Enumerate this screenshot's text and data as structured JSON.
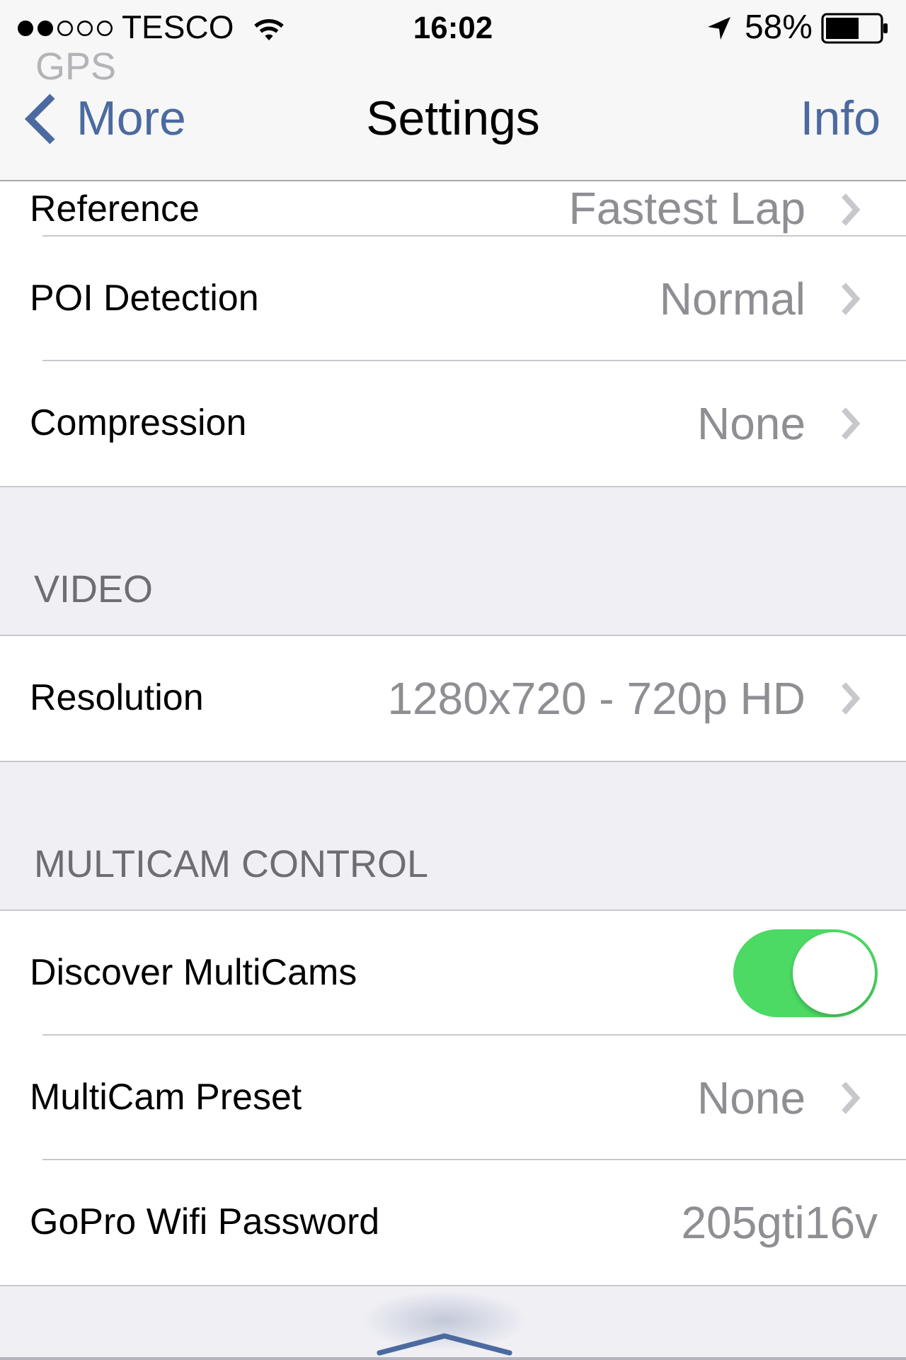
{
  "status_bar": {
    "carrier": "TESCO",
    "time": "16:02",
    "battery": "58%"
  },
  "nav_bar": {
    "back": "More",
    "title": "Settings",
    "action": "Info"
  },
  "sections": [
    {
      "header": "GPS",
      "scrolled_under": true,
      "rows": [
        {
          "kind": "disclosure",
          "label": "Reference",
          "value": "Fastest Lap",
          "partly_hidden": true
        },
        {
          "kind": "disclosure",
          "label": "POI Detection",
          "value": "Normal",
          "partly_hidden": false
        },
        {
          "kind": "disclosure",
          "label": "Compression",
          "value": "None",
          "partly_hidden": false
        }
      ]
    },
    {
      "header": "VIDEO",
      "scrolled_under": false,
      "rows": [
        {
          "kind": "disclosure",
          "label": "Resolution",
          "value": "1280x720 - 720p HD",
          "partly_hidden": false
        }
      ]
    },
    {
      "header": "MULTICAM CONTROL",
      "scrolled_under": false,
      "rows": [
        {
          "kind": "toggle",
          "label": "Discover MultiCams",
          "on": true,
          "partly_hidden": false
        },
        {
          "kind": "disclosure",
          "label": "MultiCam Preset",
          "value": "None",
          "partly_hidden": false
        },
        {
          "kind": "text",
          "label": "GoPro Wifi Password",
          "value": "205gti16v",
          "partly_hidden": false
        }
      ]
    }
  ]
}
